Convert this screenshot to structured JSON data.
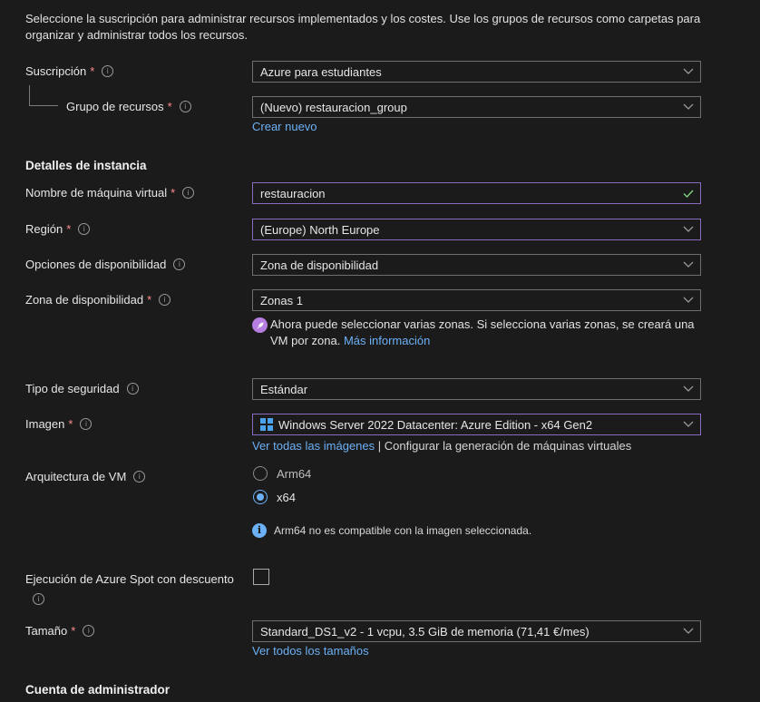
{
  "intro_text": "Seleccione la suscripción para administrar recursos implementados y los costes. Use los grupos de recursos como carpetas para organizar y administrar todos los recursos.",
  "subscription": {
    "label": "Suscripción",
    "value": "Azure para estudiantes"
  },
  "resource_group": {
    "label": "Grupo de recursos",
    "value": "(Nuevo) restauracion_group",
    "create_link": "Crear nuevo"
  },
  "instance_section": "Detalles de instancia",
  "vm_name": {
    "label": "Nombre de máquina virtual",
    "value": "restauracion"
  },
  "region": {
    "label": "Región",
    "value": "(Europe) North Europe"
  },
  "availability_options": {
    "label": "Opciones de disponibilidad",
    "value": "Zona de disponibilidad"
  },
  "availability_zone": {
    "label": "Zona de disponibilidad",
    "value": "Zonas 1",
    "notice": "Ahora puede seleccionar varias zonas. Si selecciona varias zonas, se creará una VM por zona.",
    "notice_link": "Más información"
  },
  "security_type": {
    "label": "Tipo de seguridad",
    "value": "Estándar"
  },
  "image": {
    "label": "Imagen",
    "value": "Windows Server 2022 Datacenter: Azure Edition - x64 Gen2",
    "link_all": "Ver todas las imágenes",
    "separator": "|",
    "link_config": "Configurar la generación de máquinas virtuales"
  },
  "vm_architecture": {
    "label": "Arquitectura de VM",
    "options": [
      "Arm64",
      "x64"
    ],
    "selected": "x64",
    "info": "Arm64 no es compatible con la imagen seleccionada."
  },
  "spot": {
    "label": "Ejecución de Azure Spot con descuento",
    "checked": false
  },
  "size": {
    "label": "Tamaño",
    "value": "Standard_DS1_v2 - 1 vcpu, 3.5 GiB de memoria (71,41 €/mes)",
    "link": "Ver todos los tamaños"
  },
  "admin_section": "Cuenta de administrador",
  "required_mark": "*",
  "info_glyph": "i",
  "colors": {
    "accent": "#6cb0f5",
    "required": "#ff8c8c",
    "valid": "#7fd17f",
    "focus_border": "#8b6bbf"
  }
}
